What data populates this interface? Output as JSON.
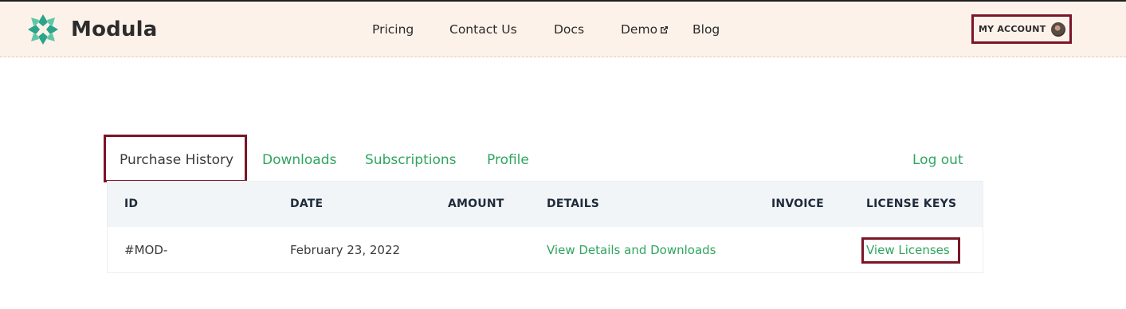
{
  "brand": {
    "name": "Modula",
    "logo_icon": "modula-logo-icon",
    "accent": "#2fa55e",
    "highlight": "#7a1528"
  },
  "nav": {
    "items": [
      {
        "label": "Pricing"
      },
      {
        "label": "Contact Us"
      },
      {
        "label": "Docs"
      },
      {
        "label": "Demo",
        "icon": "external-link-icon"
      },
      {
        "label": "Blog"
      }
    ],
    "account_label": "MY ACCOUNT",
    "account_icon": "avatar"
  },
  "tabs": {
    "items": [
      {
        "label": "Purchase History",
        "active": true
      },
      {
        "label": "Downloads"
      },
      {
        "label": "Subscriptions"
      },
      {
        "label": "Profile"
      }
    ],
    "logout_label": "Log out"
  },
  "table": {
    "columns": [
      "ID",
      "DATE",
      "AMOUNT",
      "DETAILS",
      "INVOICE",
      "LICENSE KEYS"
    ],
    "rows": [
      {
        "id": "#MOD-",
        "date": "February 23, 2022",
        "amount": "",
        "details": "View Details and Downloads",
        "invoice": "",
        "license_keys": "View Licenses"
      }
    ]
  }
}
